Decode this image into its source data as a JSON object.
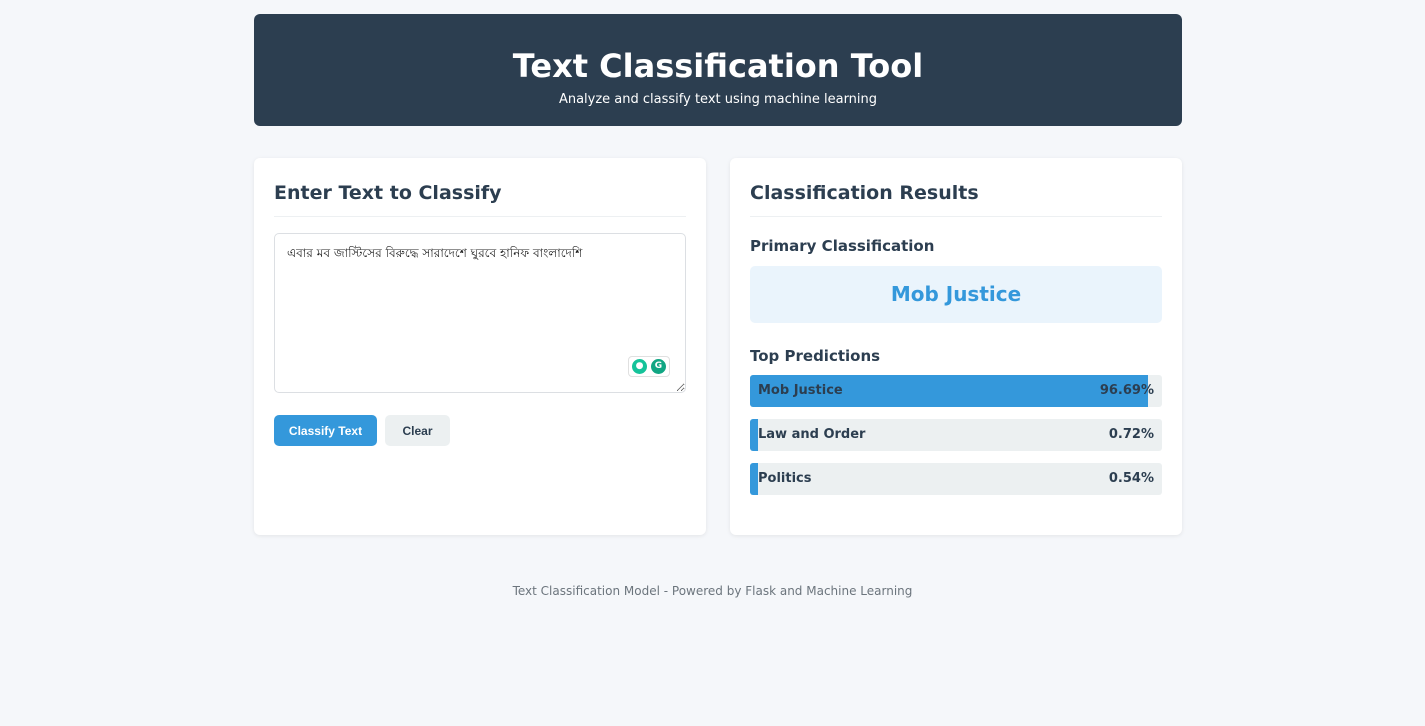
{
  "header": {
    "title": "Text Classification Tool",
    "subtitle": "Analyze and classify text using machine learning"
  },
  "input_card": {
    "title": "Enter Text to Classify",
    "text_value": "এবার মব জাস্টিসের বিরুদ্ধে সারাদেশে ঘুরবে হানিফ বাংলাদেশি",
    "classify_label": "Classify Text",
    "clear_label": "Clear"
  },
  "results_card": {
    "title": "Classification Results",
    "primary_label": "Primary Classification",
    "primary_value": "Mob Justice",
    "top_label": "Top Predictions",
    "predictions": [
      {
        "name": "Mob Justice",
        "percent": "96.69%",
        "fraction": 0.9669
      },
      {
        "name": "Law and Order",
        "percent": "0.72%",
        "fraction": 0.0072
      },
      {
        "name": "Politics",
        "percent": "0.54%",
        "fraction": 0.0054
      }
    ]
  },
  "footer": {
    "text": "Text Classification Model - Powered by Flask and Machine Learning"
  },
  "colors": {
    "header_bg": "#2c3e50",
    "accent": "#3498db",
    "page_bg": "#f5f7fa"
  },
  "icons": [
    "grammarly-bulb-icon",
    "grammarly-g-icon"
  ]
}
